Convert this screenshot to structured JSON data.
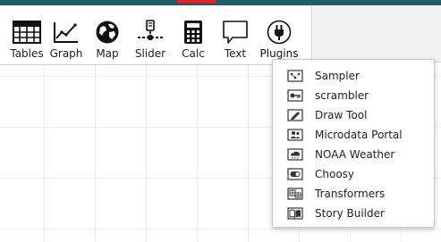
{
  "toolbar": {
    "tools": [
      {
        "label": "Tables",
        "icon": "tables-icon"
      },
      {
        "label": "Graph",
        "icon": "graph-icon"
      },
      {
        "label": "Map",
        "icon": "map-icon"
      },
      {
        "label": "Slider",
        "icon": "slider-icon"
      },
      {
        "label": "Calc",
        "icon": "calculator-icon"
      },
      {
        "label": "Text",
        "icon": "text-icon"
      },
      {
        "label": "Plugins",
        "icon": "plugins-icon"
      }
    ]
  },
  "plugins_menu": {
    "items": [
      {
        "label": "Sampler",
        "icon": "sampler-icon"
      },
      {
        "label": "scrambler",
        "icon": "scrambler-icon"
      },
      {
        "label": "Draw Tool",
        "icon": "draw-tool-icon"
      },
      {
        "label": "Microdata Portal",
        "icon": "microdata-portal-icon"
      },
      {
        "label": "NOAA Weather",
        "icon": "noaa-weather-icon"
      },
      {
        "label": "Choosy",
        "icon": "choosy-icon"
      },
      {
        "label": "Transformers",
        "icon": "transformers-icon"
      },
      {
        "label": "Story Builder",
        "icon": "story-builder-icon"
      }
    ]
  },
  "colors": {
    "top_bar": "#1f5d66",
    "top_accent": "#e3242b"
  }
}
